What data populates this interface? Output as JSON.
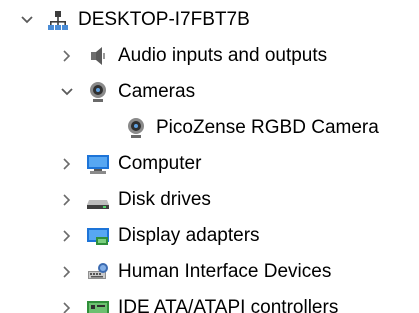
{
  "tree": {
    "root": {
      "label": "DESKTOP-I7FBT7B",
      "expanded": true,
      "icon": "computer-tree-icon"
    },
    "items": [
      {
        "label": "Audio inputs and outputs",
        "expanded": false,
        "icon": "speaker-icon"
      },
      {
        "label": "Cameras",
        "expanded": true,
        "icon": "webcam-icon",
        "children": [
          {
            "label": "PicoZense RGBD Camera",
            "icon": "webcam-icon"
          }
        ]
      },
      {
        "label": "Computer",
        "expanded": false,
        "icon": "monitor-icon"
      },
      {
        "label": "Disk drives",
        "expanded": false,
        "icon": "disk-drive-icon"
      },
      {
        "label": "Display adapters",
        "expanded": false,
        "icon": "display-adapter-icon"
      },
      {
        "label": "Human Interface Devices",
        "expanded": false,
        "icon": "hid-icon"
      },
      {
        "label": "IDE ATA/ATAPI controllers",
        "expanded": false,
        "icon": "ide-controller-icon"
      }
    ]
  },
  "colors": {
    "chevron": "#6b6b6b",
    "background": "#ffffff",
    "text": "#000000"
  }
}
